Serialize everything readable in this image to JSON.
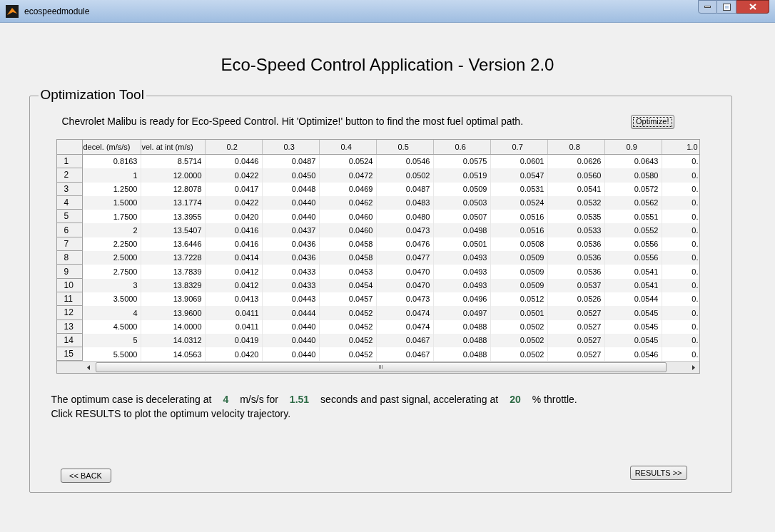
{
  "window": {
    "title": "ecospeedmodule"
  },
  "heading": "Eco-Speed Control Application - Version 2.0",
  "panel": {
    "title": "Optimization Tool",
    "message": "Chevrolet Malibu is ready for Eco-Speed Control. Hit 'Optimize!' button to find the most fuel optimal path.",
    "optimize_button": "Optimize!",
    "table": {
      "columns": [
        "decel. (m/s/s)",
        "vel. at int (m/s)",
        "0.2",
        "0.3",
        "0.4",
        "0.5",
        "0.6",
        "0.7",
        "0.8",
        "0.9",
        "1.0"
      ],
      "rows": [
        {
          "label": "1",
          "cells": [
            "0.8163",
            "8.5714",
            "0.0446",
            "0.0487",
            "0.0524",
            "0.0546",
            "0.0575",
            "0.0601",
            "0.0626",
            "0.0643",
            "0."
          ]
        },
        {
          "label": "2",
          "cells": [
            "1",
            "12.0000",
            "0.0422",
            "0.0450",
            "0.0472",
            "0.0502",
            "0.0519",
            "0.0547",
            "0.0560",
            "0.0580",
            "0."
          ]
        },
        {
          "label": "3",
          "cells": [
            "1.2500",
            "12.8078",
            "0.0417",
            "0.0448",
            "0.0469",
            "0.0487",
            "0.0509",
            "0.0531",
            "0.0541",
            "0.0572",
            "0."
          ]
        },
        {
          "label": "4",
          "cells": [
            "1.5000",
            "13.1774",
            "0.0422",
            "0.0440",
            "0.0462",
            "0.0483",
            "0.0503",
            "0.0524",
            "0.0532",
            "0.0562",
            "0."
          ]
        },
        {
          "label": "5",
          "cells": [
            "1.7500",
            "13.3955",
            "0.0420",
            "0.0440",
            "0.0460",
            "0.0480",
            "0.0507",
            "0.0516",
            "0.0535",
            "0.0551",
            "0."
          ]
        },
        {
          "label": "6",
          "cells": [
            "2",
            "13.5407",
            "0.0416",
            "0.0437",
            "0.0460",
            "0.0473",
            "0.0498",
            "0.0516",
            "0.0533",
            "0.0552",
            "0."
          ]
        },
        {
          "label": "7",
          "cells": [
            "2.2500",
            "13.6446",
            "0.0416",
            "0.0436",
            "0.0458",
            "0.0476",
            "0.0501",
            "0.0508",
            "0.0536",
            "0.0556",
            "0."
          ]
        },
        {
          "label": "8",
          "cells": [
            "2.5000",
            "13.7228",
            "0.0414",
            "0.0436",
            "0.0458",
            "0.0477",
            "0.0493",
            "0.0509",
            "0.0536",
            "0.0556",
            "0."
          ]
        },
        {
          "label": "9",
          "cells": [
            "2.7500",
            "13.7839",
            "0.0412",
            "0.0433",
            "0.0453",
            "0.0470",
            "0.0493",
            "0.0509",
            "0.0536",
            "0.0541",
            "0."
          ]
        },
        {
          "label": "10",
          "cells": [
            "3",
            "13.8329",
            "0.0412",
            "0.0433",
            "0.0454",
            "0.0470",
            "0.0493",
            "0.0509",
            "0.0537",
            "0.0541",
            "0."
          ]
        },
        {
          "label": "11",
          "cells": [
            "3.5000",
            "13.9069",
            "0.0413",
            "0.0443",
            "0.0457",
            "0.0473",
            "0.0496",
            "0.0512",
            "0.0526",
            "0.0544",
            "0."
          ]
        },
        {
          "label": "12",
          "cells": [
            "4",
            "13.9600",
            "0.0411",
            "0.0444",
            "0.0452",
            "0.0474",
            "0.0497",
            "0.0501",
            "0.0527",
            "0.0545",
            "0."
          ]
        },
        {
          "label": "13",
          "cells": [
            "4.5000",
            "14.0000",
            "0.0411",
            "0.0440",
            "0.0452",
            "0.0474",
            "0.0488",
            "0.0502",
            "0.0527",
            "0.0545",
            "0."
          ]
        },
        {
          "label": "14",
          "cells": [
            "5",
            "14.0312",
            "0.0419",
            "0.0440",
            "0.0452",
            "0.0467",
            "0.0488",
            "0.0502",
            "0.0527",
            "0.0545",
            "0."
          ]
        },
        {
          "label": "15",
          "cells": [
            "5.5000",
            "14.0563",
            "0.0420",
            "0.0440",
            "0.0452",
            "0.0467",
            "0.0488",
            "0.0502",
            "0.0527",
            "0.0546",
            "0."
          ]
        }
      ],
      "scrollbar_grip": "III"
    },
    "result": [
      {
        "kind": "label",
        "text": "The optimum case is decelerating at"
      },
      {
        "kind": "value",
        "text": "4"
      },
      {
        "kind": "label",
        "text": "m/s/s for"
      },
      {
        "kind": "value",
        "text": "1.51"
      },
      {
        "kind": "label",
        "text": "seconds and past signal, accelerating at"
      },
      {
        "kind": "value",
        "text": "20"
      },
      {
        "kind": "label",
        "text": "% throttle."
      }
    ],
    "instruction": "Click RESULTS to plot the optimum velocity trajectory.",
    "back_button": "<< BACK",
    "results_button": "RESULTS >>"
  }
}
